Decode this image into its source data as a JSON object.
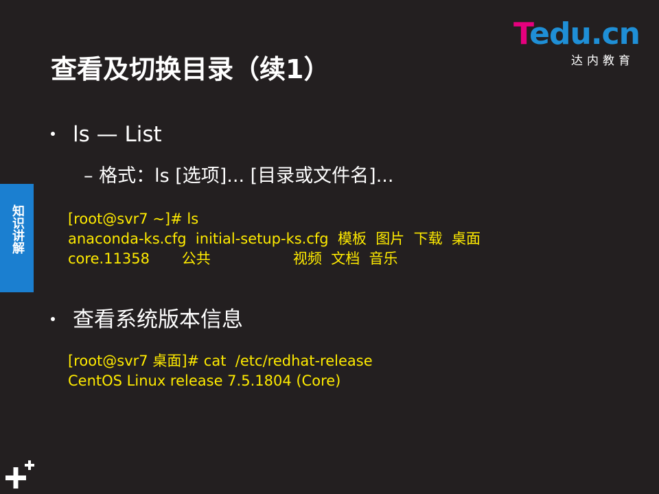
{
  "logo": {
    "main_t": "T",
    "main_rest": "edu.cn",
    "sub": "达内教育"
  },
  "title": "查看及切换目录（续1）",
  "side_tab": {
    "label": "知识讲解"
  },
  "bullet1": {
    "text": "ls — List"
  },
  "sub1": {
    "text": "– 格式：ls  [选项]...  [目录或文件名]..."
  },
  "code1": {
    "lines": [
      "[root@svr7 ~]# ls",
      "anaconda-ks.cfg  initial-setup-ks.cfg  模板  图片  下载  桌面",
      "core.11358       公共                  视频  文档  音乐"
    ]
  },
  "bullet2": {
    "text": "查看系统版本信息"
  },
  "code2": {
    "lines": [
      "[root@svr7 桌面]# cat  /etc/redhat-release",
      "CentOS Linux release 7.5.1804 (Core)"
    ]
  },
  "colors": {
    "background": "#231f20",
    "code": "#ffeb00",
    "tab": "#1b7fd0",
    "logo_t": "#e6007e",
    "logo_rest": "#1f8fd6"
  },
  "icons": {
    "corner": "plus-icon"
  }
}
